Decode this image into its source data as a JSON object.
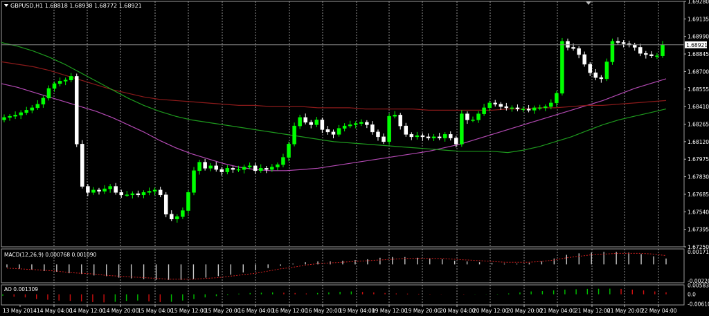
{
  "main": {
    "header": "GBPUSD,H1  1.68818 1.68938 1.68772 1.68921",
    "price_tag": "1.68921"
  },
  "macd": {
    "label": "MACD(12,26,9) 0.000768 0.001090"
  },
  "ao": {
    "label": "AO 0.001309"
  },
  "colors": {
    "background": "#000000",
    "candle_up": "#00ff00",
    "candle_down": "#ffffff",
    "ma_fast": "#b44ab4",
    "ma_slow": "#8b1a1a",
    "ma_green": "#1e9a1e",
    "macd_hist": "#c8c8c8",
    "macd_signal": "#d22020",
    "ao_up": "#00c000",
    "ao_down": "#d01010"
  },
  "chart_data": [
    {
      "type": "candlestick",
      "title": "GBPUSD,H1  1.68818 1.68938 1.68772 1.68921",
      "ylim": [
        1.6725,
        1.6928
      ],
      "yticks": [
        "1.69280",
        "1.69135",
        "1.68990",
        "1.68845",
        "1.68700",
        "1.68555",
        "1.68410",
        "1.68265",
        "1.68120",
        "1.67975",
        "1.67830",
        "1.67685",
        "1.67540",
        "1.67395",
        "1.67250"
      ],
      "xticks": [
        "13 May 2014",
        "14 May 04:00",
        "14 May 12:00",
        "14 May 20:00",
        "15 May 04:00",
        "15 May 12:00",
        "15 May 20:00",
        "16 May 04:00",
        "16 May 12:00",
        "16 May 20:00",
        "19 May 04:00",
        "19 May 12:00",
        "19 May 20:00",
        "20 May 04:00",
        "20 May 12:00",
        "20 May 20:00",
        "21 May 04:00",
        "21 May 12:00",
        "21 May 20:00",
        "22 May 04:00"
      ],
      "last_price": 1.68921,
      "close": [
        1.6832,
        1.6833,
        1.6834,
        1.6836,
        1.6838,
        1.684,
        1.6843,
        1.6848,
        1.6856,
        1.686,
        1.6862,
        1.6863,
        1.6866,
        1.681,
        1.6775,
        1.677,
        1.6772,
        1.6771,
        1.6773,
        1.6775,
        1.677,
        1.6768,
        1.6768,
        1.6769,
        1.6768,
        1.677,
        1.6771,
        1.6772,
        1.6768,
        1.6752,
        1.6748,
        1.675,
        1.6755,
        1.677,
        1.6788,
        1.6795,
        1.679,
        1.6792,
        1.6789,
        1.6787,
        1.679,
        1.6789,
        1.6789,
        1.6791,
        1.6792,
        1.6788,
        1.679,
        1.6789,
        1.6791,
        1.6793,
        1.6799,
        1.681,
        1.6825,
        1.6832,
        1.6828,
        1.6826,
        1.683,
        1.6822,
        1.682,
        1.6818,
        1.6823,
        1.6825,
        1.6826,
        1.6827,
        1.6828,
        1.6826,
        1.682,
        1.6816,
        1.6812,
        1.6833,
        1.6834,
        1.6825,
        1.6818,
        1.6816,
        1.6817,
        1.6816,
        1.6815,
        1.6816,
        1.6815,
        1.6818,
        1.6815,
        1.681,
        1.6835,
        1.683,
        1.683,
        1.6835,
        1.684,
        1.6844,
        1.6843,
        1.6841,
        1.684,
        1.684,
        1.6839,
        1.6839,
        1.6838,
        1.684,
        1.684,
        1.6841,
        1.6844,
        1.6852,
        1.6895,
        1.689,
        1.6889,
        1.6884,
        1.6876,
        1.6869,
        1.6865,
        1.6864,
        1.6878,
        1.6895,
        1.6894,
        1.6893,
        1.6892,
        1.689,
        1.6885,
        1.6884,
        1.6883,
        1.6883,
        1.6892
      ],
      "series": [
        {
          "name": "",
          "color": "#b44ab4",
          "values": [
            1.686,
            1.6857,
            1.6853,
            1.6849,
            1.6845,
            1.6841,
            1.6837,
            1.6832,
            1.6826,
            1.682,
            1.6813,
            1.6807,
            1.6802,
            1.6798,
            1.6794,
            1.6791,
            1.6789,
            1.6788,
            1.6788,
            1.6789,
            1.679,
            1.6792,
            1.6794,
            1.6796,
            1.6798,
            1.68,
            1.6802,
            1.6804,
            1.6807,
            1.681,
            1.6814,
            1.6818,
            1.6822,
            1.6826,
            1.683,
            1.6834,
            1.6838,
            1.6842,
            1.6846,
            1.6851,
            1.6856,
            1.686,
            1.6864
          ]
        },
        {
          "name": "",
          "color": "#8b1a1a",
          "values": [
            1.6878,
            1.6876,
            1.6874,
            1.6871,
            1.6867,
            1.6863,
            1.6859,
            1.6855,
            1.6852,
            1.6849,
            1.6847,
            1.6846,
            1.6845,
            1.6844,
            1.6843,
            1.6842,
            1.6842,
            1.6841,
            1.6841,
            1.6841,
            1.684,
            1.684,
            1.684,
            1.6839,
            1.6839,
            1.6839,
            1.6839,
            1.6838,
            1.6838,
            1.6838,
            1.6838,
            1.6838,
            1.6839,
            1.6839,
            1.684,
            1.684,
            1.6841,
            1.6842,
            1.6842,
            1.6843,
            1.6844,
            1.6845,
            1.6846
          ]
        },
        {
          "name": "",
          "color": "#1e9a1e",
          "values": [
            1.6894,
            1.6891,
            1.6887,
            1.6882,
            1.6876,
            1.6869,
            1.6862,
            1.6855,
            1.6848,
            1.6842,
            1.6837,
            1.6833,
            1.683,
            1.6828,
            1.6826,
            1.6824,
            1.6822,
            1.682,
            1.6818,
            1.6816,
            1.6814,
            1.6812,
            1.6811,
            1.681,
            1.6809,
            1.6808,
            1.6807,
            1.6806,
            1.6805,
            1.6804,
            1.6804,
            1.6804,
            1.6803,
            1.6805,
            1.6808,
            1.6812,
            1.6816,
            1.6821,
            1.6826,
            1.683,
            1.6833,
            1.6836,
            1.6839
          ]
        }
      ]
    },
    {
      "type": "bar",
      "title": "MACD(12,26,9) 0.000768 0.001090",
      "ylim": [
        -0.0025,
        0.0021
      ],
      "yticks": [
        "0.00171",
        "-0.00220"
      ],
      "values": [
        -0.0004,
        -0.0006,
        -0.0007,
        -0.0009,
        -0.001,
        -0.0012,
        -0.0013,
        -0.0015,
        -0.0016,
        -0.0018,
        -0.0019,
        -0.002,
        -0.0021,
        -0.0021,
        -0.0021,
        -0.002,
        -0.0018,
        -0.0016,
        -0.0014,
        -0.0011,
        -0.0008,
        -0.0005,
        -0.0002,
        0.0001,
        0.0003,
        0.0004,
        0.0004,
        0.0005,
        0.0006,
        0.0007,
        0.0009,
        0.001,
        0.001,
        0.0009,
        0.0008,
        0.0007,
        0.0005,
        0.0004,
        0.0003,
        0.0002,
        0.0001,
        0.0001,
        0.0002,
        0.0004,
        0.0008,
        0.0013,
        0.0015,
        0.0016,
        0.0017,
        0.0017,
        0.0016,
        0.0014,
        0.0011,
        0.0008
      ],
      "signal": [
        -0.0005,
        -0.0006,
        -0.0007,
        -0.0008,
        -0.0009,
        -0.0011,
        -0.0012,
        -0.0013,
        -0.0015,
        -0.0016,
        -0.0017,
        -0.0018,
        -0.0019,
        -0.002,
        -0.002,
        -0.002,
        -0.0019,
        -0.0018,
        -0.0016,
        -0.0014,
        -0.0012,
        -0.0009,
        -0.0006,
        -0.0004,
        -0.0001,
        0.0001,
        0.0002,
        0.0003,
        0.0004,
        0.0005,
        0.0006,
        0.0007,
        0.0008,
        0.0008,
        0.0008,
        0.0008,
        0.0007,
        0.0006,
        0.0005,
        0.0004,
        0.0003,
        0.0003,
        0.0003,
        0.0004,
        0.0006,
        0.0009,
        0.0011,
        0.0013,
        0.0014,
        0.0015,
        0.0015,
        0.0015,
        0.0014,
        0.0012
      ]
    },
    {
      "type": "bar",
      "title": "AO 0.001309",
      "ylim": [
        -0.0068,
        0.006
      ],
      "yticks": [
        "0.00583",
        "0.0",
        "-0.00610"
      ],
      "values": [
        -0.001,
        -0.0015,
        -0.002,
        -0.003,
        -0.0035,
        -0.004,
        -0.0042,
        -0.0045,
        -0.005,
        -0.0052,
        -0.0048,
        -0.0042,
        -0.004,
        -0.0045,
        -0.005,
        -0.0048,
        -0.004,
        -0.003,
        -0.002,
        -0.0012,
        -0.0005,
        0.0004,
        0.0008,
        0.001,
        0.0012,
        0.001,
        0.0008,
        0.0005,
        0.0008,
        0.0012,
        0.0016,
        0.0018,
        0.0015,
        0.0012,
        0.0008,
        0.0005,
        0.0004,
        0.0003,
        0.0002,
        0.0001,
        0.0,
        -0.0002,
        -0.0001,
        0.0001,
        0.0002,
        0.0005,
        0.0012,
        0.0018,
        0.002,
        0.0025,
        0.003,
        0.0032,
        0.0034,
        0.0035,
        0.0036,
        0.0034,
        0.003,
        0.0025,
        0.0018,
        0.0013
      ]
    }
  ]
}
